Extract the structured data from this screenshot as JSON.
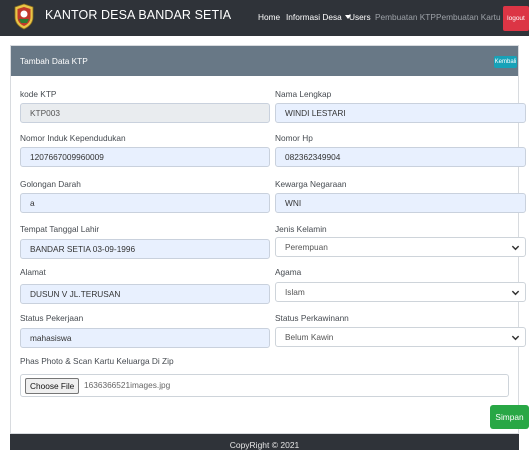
{
  "brand": {
    "title": "KANTOR DESA BANDAR SETIA"
  },
  "nav": {
    "home": "Home",
    "info": "Informasi Desa",
    "users": "Users",
    "pembuatan_ktp": "Pembuatan KTP",
    "pembuatan_kk": "Pembuatan Kartu Keluarga",
    "logout": "logout"
  },
  "card": {
    "title": "Tambah Data KTP",
    "back_label": "Kembali"
  },
  "form": {
    "kode_ktp": {
      "label": "kode KTP",
      "value": "KTP003"
    },
    "nama": {
      "label": "Nama Lengkap",
      "value": "WINDI LESTARI"
    },
    "nik": {
      "label": "Nomor Induk Kependudukan",
      "value": "1207667009960009"
    },
    "hp": {
      "label": "Nomor Hp",
      "value": "082362349904"
    },
    "gol_darah": {
      "label": "Golongan Darah",
      "value": "a"
    },
    "kewarganegaraan": {
      "label": "Kewarga Negaraan",
      "value": "WNI"
    },
    "ttl": {
      "label": "Tempat Tanggal Lahir",
      "value": "BANDAR SETIA 03-09-1996"
    },
    "jk": {
      "label": "Jenis Kelamin",
      "value": "Perempuan"
    },
    "alamat": {
      "label": "Alamat",
      "value": "DUSUN V JL.TERUSAN"
    },
    "agama": {
      "label": "Agama",
      "value": "Islam"
    },
    "pekerjaan": {
      "label": "Status Pekerjaan",
      "value": "mahasiswa"
    },
    "perkawinan": {
      "label": "Status Perkawinann",
      "value": "Belum Kawin"
    },
    "photo": {
      "label": "Phas Photo & Scan Kartu Keluarga Di Zip",
      "button": "Choose File",
      "filename": "1636366521images.jpg"
    },
    "submit_label": "Simpan"
  },
  "footer": {
    "text": "CopyRight © 2021"
  },
  "colors": {
    "navbar": "#2f3339",
    "card_header": "#687886",
    "kembali": "#17a2b8",
    "logout": "#dc3545",
    "simpan": "#28a745",
    "autofill": "#e8f0fe"
  }
}
